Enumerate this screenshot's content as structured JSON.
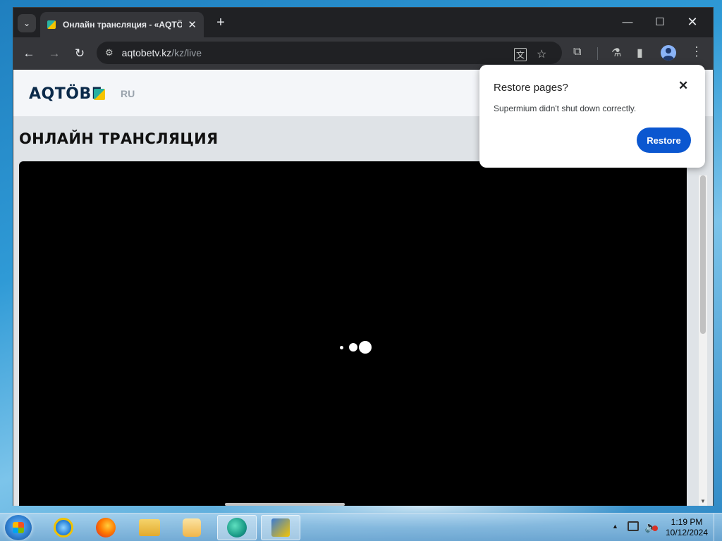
{
  "browser": {
    "tab_title": "Онлайн трансляция - «AQTÖBE»",
    "tab_close": "✕",
    "new_tab": "+",
    "url_host": "aqtobetv.kz",
    "url_path": "/kz/live",
    "win_min": "—",
    "win_max": "☐",
    "win_close": "✕"
  },
  "site": {
    "logo": "AQTÖBE",
    "lang": "RU",
    "page_title": "ОНЛАЙН ТРАНСЛЯЦИЯ"
  },
  "popup": {
    "title": "Restore pages?",
    "message": "Supermium didn't shut down correctly.",
    "close": "✕",
    "button": "Restore",
    "button_color": "#0b57d0"
  },
  "taskbar": {
    "time": "1:19 PM",
    "date": "10/12/2024",
    "apps": [
      "internet-explorer",
      "firefox",
      "file-explorer",
      "media-player",
      "edge-like-app",
      "notes-app"
    ]
  }
}
